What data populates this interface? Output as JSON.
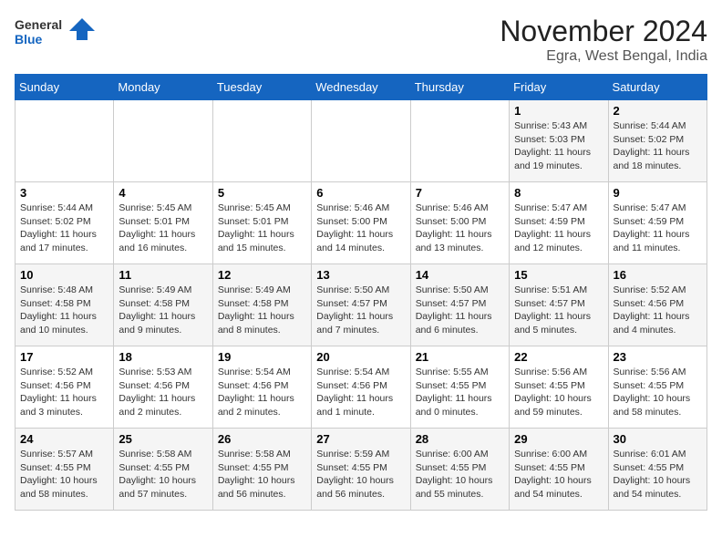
{
  "header": {
    "logo_line1": "General",
    "logo_line2": "Blue",
    "month": "November 2024",
    "location": "Egra, West Bengal, India"
  },
  "days_of_week": [
    "Sunday",
    "Monday",
    "Tuesday",
    "Wednesday",
    "Thursday",
    "Friday",
    "Saturday"
  ],
  "weeks": [
    [
      {
        "num": "",
        "detail": ""
      },
      {
        "num": "",
        "detail": ""
      },
      {
        "num": "",
        "detail": ""
      },
      {
        "num": "",
        "detail": ""
      },
      {
        "num": "",
        "detail": ""
      },
      {
        "num": "1",
        "detail": "Sunrise: 5:43 AM\nSunset: 5:03 PM\nDaylight: 11 hours and 19 minutes."
      },
      {
        "num": "2",
        "detail": "Sunrise: 5:44 AM\nSunset: 5:02 PM\nDaylight: 11 hours and 18 minutes."
      }
    ],
    [
      {
        "num": "3",
        "detail": "Sunrise: 5:44 AM\nSunset: 5:02 PM\nDaylight: 11 hours and 17 minutes."
      },
      {
        "num": "4",
        "detail": "Sunrise: 5:45 AM\nSunset: 5:01 PM\nDaylight: 11 hours and 16 minutes."
      },
      {
        "num": "5",
        "detail": "Sunrise: 5:45 AM\nSunset: 5:01 PM\nDaylight: 11 hours and 15 minutes."
      },
      {
        "num": "6",
        "detail": "Sunrise: 5:46 AM\nSunset: 5:00 PM\nDaylight: 11 hours and 14 minutes."
      },
      {
        "num": "7",
        "detail": "Sunrise: 5:46 AM\nSunset: 5:00 PM\nDaylight: 11 hours and 13 minutes."
      },
      {
        "num": "8",
        "detail": "Sunrise: 5:47 AM\nSunset: 4:59 PM\nDaylight: 11 hours and 12 minutes."
      },
      {
        "num": "9",
        "detail": "Sunrise: 5:47 AM\nSunset: 4:59 PM\nDaylight: 11 hours and 11 minutes."
      }
    ],
    [
      {
        "num": "10",
        "detail": "Sunrise: 5:48 AM\nSunset: 4:58 PM\nDaylight: 11 hours and 10 minutes."
      },
      {
        "num": "11",
        "detail": "Sunrise: 5:49 AM\nSunset: 4:58 PM\nDaylight: 11 hours and 9 minutes."
      },
      {
        "num": "12",
        "detail": "Sunrise: 5:49 AM\nSunset: 4:58 PM\nDaylight: 11 hours and 8 minutes."
      },
      {
        "num": "13",
        "detail": "Sunrise: 5:50 AM\nSunset: 4:57 PM\nDaylight: 11 hours and 7 minutes."
      },
      {
        "num": "14",
        "detail": "Sunrise: 5:50 AM\nSunset: 4:57 PM\nDaylight: 11 hours and 6 minutes."
      },
      {
        "num": "15",
        "detail": "Sunrise: 5:51 AM\nSunset: 4:57 PM\nDaylight: 11 hours and 5 minutes."
      },
      {
        "num": "16",
        "detail": "Sunrise: 5:52 AM\nSunset: 4:56 PM\nDaylight: 11 hours and 4 minutes."
      }
    ],
    [
      {
        "num": "17",
        "detail": "Sunrise: 5:52 AM\nSunset: 4:56 PM\nDaylight: 11 hours and 3 minutes."
      },
      {
        "num": "18",
        "detail": "Sunrise: 5:53 AM\nSunset: 4:56 PM\nDaylight: 11 hours and 2 minutes."
      },
      {
        "num": "19",
        "detail": "Sunrise: 5:54 AM\nSunset: 4:56 PM\nDaylight: 11 hours and 2 minutes."
      },
      {
        "num": "20",
        "detail": "Sunrise: 5:54 AM\nSunset: 4:56 PM\nDaylight: 11 hours and 1 minute."
      },
      {
        "num": "21",
        "detail": "Sunrise: 5:55 AM\nSunset: 4:55 PM\nDaylight: 11 hours and 0 minutes."
      },
      {
        "num": "22",
        "detail": "Sunrise: 5:56 AM\nSunset: 4:55 PM\nDaylight: 10 hours and 59 minutes."
      },
      {
        "num": "23",
        "detail": "Sunrise: 5:56 AM\nSunset: 4:55 PM\nDaylight: 10 hours and 58 minutes."
      }
    ],
    [
      {
        "num": "24",
        "detail": "Sunrise: 5:57 AM\nSunset: 4:55 PM\nDaylight: 10 hours and 58 minutes."
      },
      {
        "num": "25",
        "detail": "Sunrise: 5:58 AM\nSunset: 4:55 PM\nDaylight: 10 hours and 57 minutes."
      },
      {
        "num": "26",
        "detail": "Sunrise: 5:58 AM\nSunset: 4:55 PM\nDaylight: 10 hours and 56 minutes."
      },
      {
        "num": "27",
        "detail": "Sunrise: 5:59 AM\nSunset: 4:55 PM\nDaylight: 10 hours and 56 minutes."
      },
      {
        "num": "28",
        "detail": "Sunrise: 6:00 AM\nSunset: 4:55 PM\nDaylight: 10 hours and 55 minutes."
      },
      {
        "num": "29",
        "detail": "Sunrise: 6:00 AM\nSunset: 4:55 PM\nDaylight: 10 hours and 54 minutes."
      },
      {
        "num": "30",
        "detail": "Sunrise: 6:01 AM\nSunset: 4:55 PM\nDaylight: 10 hours and 54 minutes."
      }
    ]
  ]
}
